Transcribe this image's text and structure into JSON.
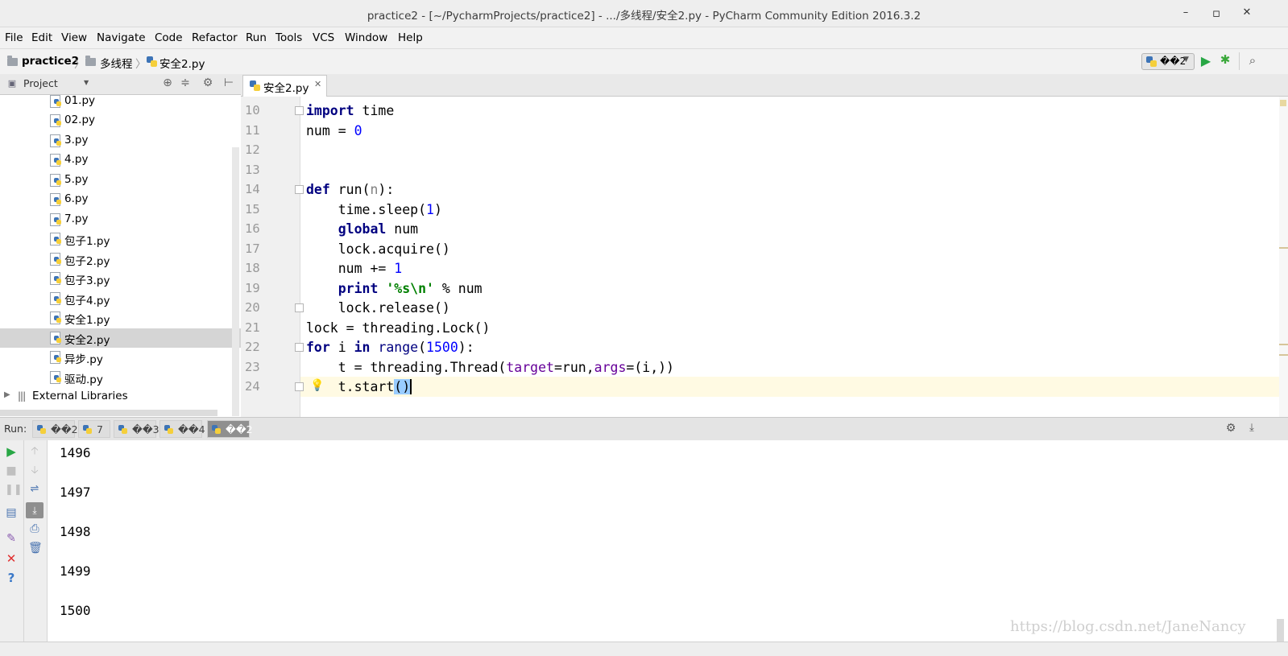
{
  "window": {
    "title": "practice2 - [~/PycharmProjects/practice2] - .../多线程/安全2.py - PyCharm Community Edition 2016.3.2",
    "minimize": "–",
    "maximize": "▫",
    "close": "✕"
  },
  "menu": [
    "File",
    "Edit",
    "View",
    "Navigate",
    "Code",
    "Refactor",
    "Run",
    "Tools",
    "VCS",
    "Window",
    "Help"
  ],
  "breadcrumb": [
    "practice2",
    "多线程",
    "安全2.py"
  ],
  "run_config": "��2",
  "project_panel": {
    "title": "Project",
    "files": [
      "01.py",
      "02.py",
      "3.py",
      "4.py",
      "5.py",
      "6.py",
      "7.py",
      "包子1.py",
      "包子2.py",
      "包子3.py",
      "包子4.py",
      "安全1.py",
      "安全2.py",
      "异步.py",
      "驱动.py"
    ],
    "selected": "安全2.py",
    "external": "External Libraries"
  },
  "editor": {
    "tab": "安全2.py",
    "line_numbers": [
      "10",
      "11",
      "12",
      "13",
      "14",
      "15",
      "16",
      "17",
      "18",
      "19",
      "20",
      "21",
      "22",
      "23",
      "24"
    ],
    "current_line": "24"
  },
  "run_panel": {
    "label": "Run:",
    "tabs": [
      "��2",
      "7",
      "��3",
      "��4",
      "��2"
    ],
    "active_tab": "��2",
    "output": [
      "1496",
      "1497",
      "1498",
      "1499",
      "1500"
    ]
  },
  "watermark": "https://blog.csdn.net/JaneNancy",
  "icons": {
    "run": "run-icon",
    "debug": "debug-icon",
    "search": "search-icon",
    "settings": "gear-icon"
  },
  "colors": {
    "keyword": "#000080",
    "number": "#0000ff",
    "string": "#008000",
    "current_line_bg": "#fffae3",
    "run_green": "#28a745"
  }
}
